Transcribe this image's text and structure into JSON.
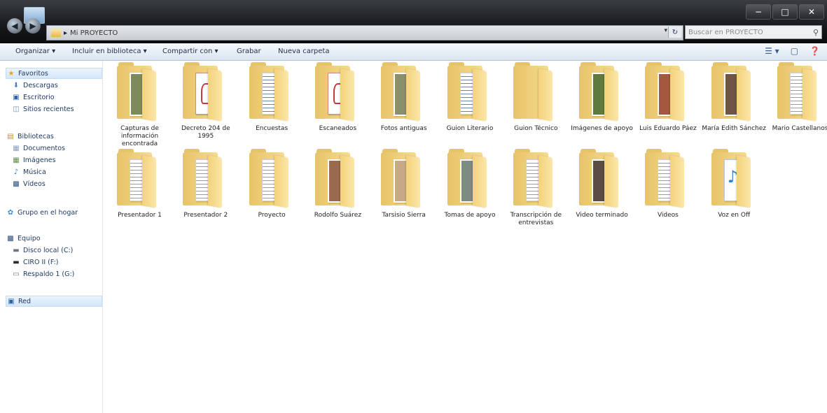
{
  "titlebar": {
    "controls": [
      {
        "label": "−",
        "icon": "minimize-icon"
      },
      {
        "label": "□",
        "icon": "maximize-icon"
      },
      {
        "label": "✕",
        "icon": "close-icon"
      }
    ]
  },
  "address": {
    "path": "Mi PROYECTO",
    "search_placeholder": "Buscar en PROYECTO"
  },
  "toolbar": {
    "organize": "Organizar ▾",
    "include": "Incluir en biblioteca ▾",
    "share": "Compartir con ▾",
    "burn": "Grabar",
    "new_folder": "Nueva carpeta"
  },
  "sidebar": {
    "favorites": {
      "label": "Favoritos",
      "icon": "star-icon"
    },
    "fav_items": [
      {
        "label": "Descargas",
        "icon": "download-icon"
      },
      {
        "label": "Escritorio",
        "icon": "desktop-icon"
      },
      {
        "label": "Sitios recientes",
        "icon": "recent-icon"
      }
    ],
    "libraries": {
      "label": "Bibliotecas",
      "icon": "library-icon"
    },
    "lib_items": [
      {
        "label": "Documentos",
        "icon": "documents-icon"
      },
      {
        "label": "Imágenes",
        "icon": "pictures-icon"
      },
      {
        "label": "Música",
        "icon": "music-icon"
      },
      {
        "label": "Vídeos",
        "icon": "videos-icon"
      }
    ],
    "homegroup": {
      "label": "Grupo en el hogar",
      "icon": "homegroup-icon"
    },
    "computer": {
      "label": "Equipo",
      "icon": "computer-icon"
    },
    "drives": [
      {
        "label": "Disco local (C:)",
        "icon": "drive-icon"
      },
      {
        "label": "CIRO II (F:)",
        "icon": "drive-icon"
      },
      {
        "label": "Respaldo 1 (G:)",
        "icon": "drive-icon"
      }
    ],
    "network": {
      "label": "Red",
      "icon": "network-icon"
    }
  },
  "folders": [
    {
      "label": "Capturas de información encontrada",
      "preview": "photo",
      "photo": "#7f8a5c"
    },
    {
      "label": "Decreto 204 de 1995",
      "preview": "pdf"
    },
    {
      "label": "Encuestas",
      "preview": "bluelines"
    },
    {
      "label": "Escaneados",
      "preview": "pdf"
    },
    {
      "label": "Fotos antiguas",
      "preview": "photo",
      "photo": "#8c8f6b"
    },
    {
      "label": "Guion Literario",
      "preview": "bluelines"
    },
    {
      "label": "Guion Técnico",
      "preview": "empty"
    },
    {
      "label": "Imágenes de apoyo",
      "preview": "photo",
      "photo": "#5e7a3e"
    },
    {
      "label": "Luis Eduardo Páez",
      "preview": "photo",
      "photo": "#a4583e"
    },
    {
      "label": "María Edith Sánchez",
      "preview": "photo",
      "photo": "#6e5548"
    },
    {
      "label": "Mario Castellanos",
      "preview": "lines"
    },
    {
      "label": "Presentador 1",
      "preview": "lines"
    },
    {
      "label": "Presentador 2",
      "preview": "lines"
    },
    {
      "label": "Proyecto",
      "preview": "lines"
    },
    {
      "label": "Rodolfo Suárez",
      "preview": "photo",
      "photo": "#9a6a4e"
    },
    {
      "label": "Tarsisio Sierra",
      "preview": "photo",
      "photo": "#c8a985"
    },
    {
      "label": "Tomas de apoyo",
      "preview": "photo",
      "photo": "#7d8b83"
    },
    {
      "label": "Transcripción de entrevistas",
      "preview": "lines"
    },
    {
      "label": "Video terminado",
      "preview": "photo",
      "photo": "#5a4e42"
    },
    {
      "label": "Videos",
      "preview": "lines"
    },
    {
      "label": "Voz en Off",
      "preview": "music"
    }
  ]
}
